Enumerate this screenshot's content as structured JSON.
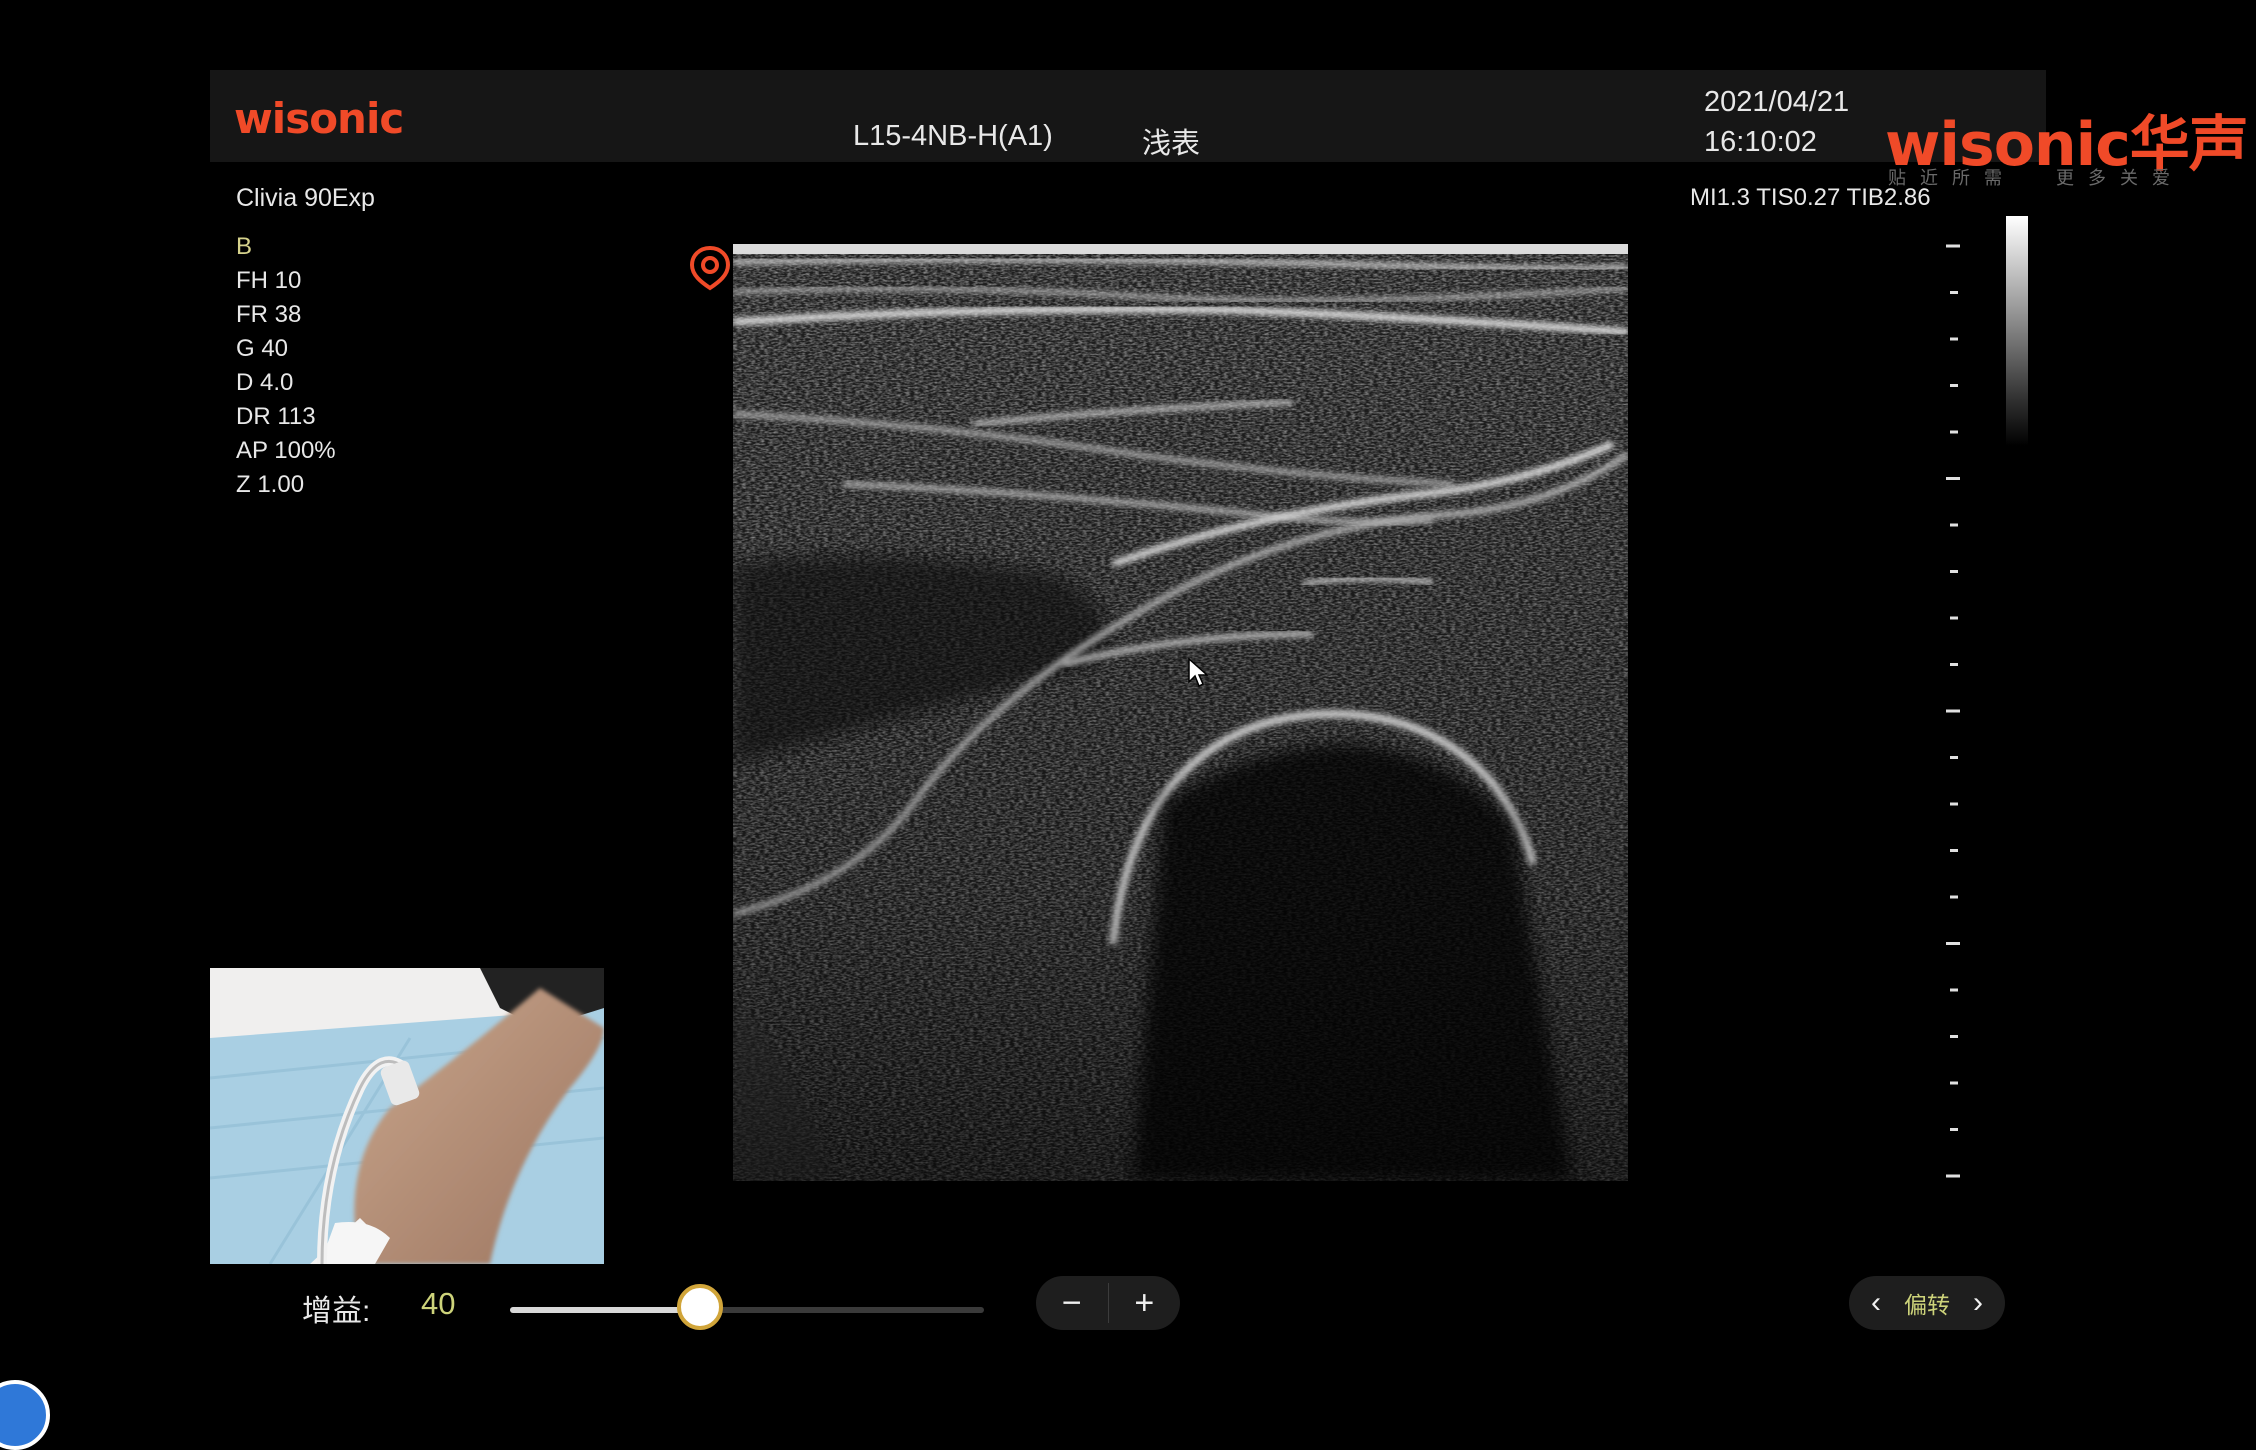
{
  "header": {
    "logo_text": "wisonic",
    "probe": "L15-4NB-H(A1)",
    "preset": "浅表",
    "date": "2021/04/21",
    "time": "16:10:02",
    "brand": "wisonic华声",
    "slogan_left": "贴近所需",
    "slogan_right": "更多关爱"
  },
  "device": {
    "model": "Clivia 90Exp",
    "safety_indices": "MI1.3 TIS0.27 TIB2.86"
  },
  "params": {
    "mode": "B",
    "fh": "FH 10",
    "fr": "FR 38",
    "g": "G 40",
    "d": "D 4.0",
    "dr": "DR 113",
    "ap": "AP 100%",
    "z": "Z 1.00"
  },
  "controls": {
    "gain_label": "增益:",
    "gain_value": "40",
    "gain_level": 0.4,
    "minus": "−",
    "plus": "+",
    "steer_label": "偏转",
    "steer_prev": "‹",
    "steer_next": "›"
  },
  "colors": {
    "brand": "#f04a28",
    "value_accent": "#cdd37a",
    "mode_accent": "#d6d28c"
  },
  "icons": {
    "orientation": "probe-orientation-marker-icon",
    "cursor": "mouse-pointer-icon"
  }
}
